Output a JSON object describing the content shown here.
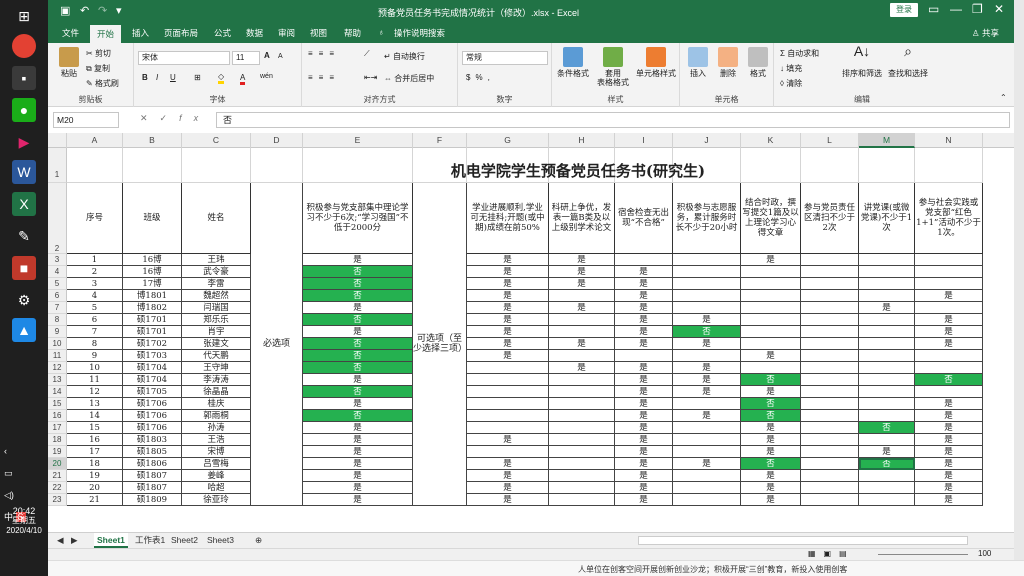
{
  "window": {
    "title": "预备党员任务书完成情况统计（修改）.xlsx  -  Excel",
    "login": "登录"
  },
  "menu": {
    "items": [
      "文件",
      "开始",
      "插入",
      "页面布局",
      "公式",
      "数据",
      "审阅",
      "视图",
      "帮助"
    ],
    "active": "开始",
    "tell_me": "操作说明搜索",
    "share": "共享"
  },
  "ribbon": {
    "clipboard": {
      "paste": "粘贴",
      "cut": "剪切",
      "copy": "复制",
      "painter": "格式刷",
      "label": "剪贴板"
    },
    "font": {
      "name": "宋体",
      "size": "11",
      "bold": "B",
      "italic": "I",
      "underline": "U",
      "grow": "A",
      "shrink": "A",
      "wen": "wén",
      "label": "字体"
    },
    "align": {
      "wrap": "自动换行",
      "merge": "合并后居中",
      "label": "对齐方式"
    },
    "number": {
      "format": "常规",
      "label": "数字"
    },
    "styles": {
      "cond": "条件格式",
      "table": "套用\n表格格式",
      "cell": "单元格样式",
      "label": "样式"
    },
    "cells": {
      "insert": "插入",
      "delete": "删除",
      "format": "格式",
      "label": "单元格"
    },
    "edit": {
      "autosum": "自动求和",
      "fill": "填充",
      "clear": "清除",
      "sort": "排序和筛选",
      "find": "查找和选择",
      "label": "编辑"
    }
  },
  "formula": {
    "cell_ref": "M20",
    "value": "否"
  },
  "columns": [
    "A",
    "B",
    "C",
    "D",
    "E",
    "F",
    "G",
    "H",
    "I",
    "J",
    "K",
    "L",
    "M",
    "N"
  ],
  "selected_col": "M",
  "selected_row": "20",
  "sheet_title": "机电学院学生预备党员任务书(研究生)",
  "headers": {
    "A": "序号",
    "B": "班级",
    "C": "姓名",
    "E": "积极参与党支部集中理论学习不少于6次;“学习强国”不低于2000分",
    "G": "学业进展顺利,学业可无挂科;开题(或中期)成绩在前50%",
    "H": "科研上争优，发表一篇B类及以上级别学术论文",
    "I": "宿舍检查无出现“不合格”",
    "J": "积极参与志愿服务，累计服务时长不少于20小时",
    "K": "结合时政，撰写提交1篇及以上理论学习心得文章",
    "L": "参与党员责任区清扫不少于2次",
    "M": "讲党课(或微党课)不少于1次",
    "N": "参与社会实践或党支部“红色1+1”活动不少于1次。"
  },
  "merged": {
    "D": "必选项",
    "F": "可选项（至少选择三项）"
  },
  "yes": "是",
  "no": "否",
  "rows": [
    {
      "r": "3",
      "n": "1",
      "cls": "16博",
      "name": "王玮",
      "E": "是",
      "G": "是",
      "H": "是",
      "I": "",
      "J": "",
      "K": "是",
      "L": "",
      "M": "",
      "N": ""
    },
    {
      "r": "4",
      "n": "2",
      "cls": "16博",
      "name": "武令豪",
      "E": "否",
      "G": "是",
      "H": "是",
      "I": "是",
      "J": "",
      "K": "",
      "L": "",
      "M": "",
      "N": ""
    },
    {
      "r": "5",
      "n": "3",
      "cls": "17博",
      "name": "李雷",
      "E": "否",
      "G": "是",
      "H": "是",
      "I": "是",
      "J": "",
      "K": "",
      "L": "",
      "M": "",
      "N": ""
    },
    {
      "r": "6",
      "n": "4",
      "cls": "博1801",
      "name": "魏超然",
      "E": "否",
      "G": "是",
      "H": "",
      "I": "是",
      "J": "",
      "K": "",
      "L": "",
      "M": "",
      "N": "是"
    },
    {
      "r": "7",
      "n": "5",
      "cls": "博1802",
      "name": "闫瑞国",
      "E": "是",
      "G": "是",
      "H": "是",
      "I": "是",
      "J": "",
      "K": "",
      "L": "",
      "M": "是",
      "N": ""
    },
    {
      "r": "8",
      "n": "6",
      "cls": "硕1701",
      "name": "郑乐乐",
      "E": "否",
      "G": "是",
      "H": "",
      "I": "是",
      "J": "是",
      "K": "",
      "L": "",
      "M": "",
      "N": "是"
    },
    {
      "r": "9",
      "n": "7",
      "cls": "硕1701",
      "name": "肖宇",
      "E": "是",
      "G": "是",
      "H": "",
      "I": "是",
      "J": "否",
      "K": "",
      "L": "",
      "M": "",
      "N": "是"
    },
    {
      "r": "10",
      "n": "8",
      "cls": "硕1702",
      "name": "张建文",
      "E": "否",
      "G": "是",
      "H": "是",
      "I": "是",
      "J": "是",
      "K": "",
      "L": "",
      "M": "",
      "N": "是"
    },
    {
      "r": "11",
      "n": "9",
      "cls": "硕1703",
      "name": "代天鹏",
      "E": "否",
      "G": "是",
      "H": "",
      "I": "",
      "J": "",
      "K": "是",
      "L": "",
      "M": "",
      "N": ""
    },
    {
      "r": "12",
      "n": "10",
      "cls": "硕1704",
      "name": "王守坤",
      "E": "否",
      "G": "",
      "H": "是",
      "I": "是",
      "J": "是",
      "K": "",
      "L": "",
      "M": "",
      "N": ""
    },
    {
      "r": "13",
      "n": "11",
      "cls": "硕1704",
      "name": "李涛涛",
      "E": "是",
      "G": "",
      "H": "",
      "I": "是",
      "J": "是",
      "K": "否",
      "L": "",
      "M": "",
      "N": "否"
    },
    {
      "r": "14",
      "n": "12",
      "cls": "硕1705",
      "name": "徐晶晶",
      "E": "否",
      "G": "",
      "H": "",
      "I": "是",
      "J": "是",
      "K": "是",
      "L": "",
      "M": "",
      "N": ""
    },
    {
      "r": "15",
      "n": "13",
      "cls": "硕1706",
      "name": "桂庆",
      "E": "是",
      "G": "",
      "H": "",
      "I": "是",
      "J": "",
      "K": "否",
      "L": "",
      "M": "",
      "N": "是"
    },
    {
      "r": "16",
      "n": "14",
      "cls": "硕1706",
      "name": "郭雨桐",
      "E": "否",
      "G": "",
      "H": "",
      "I": "是",
      "J": "是",
      "K": "否",
      "L": "",
      "M": "",
      "N": "是"
    },
    {
      "r": "17",
      "n": "15",
      "cls": "硕1706",
      "name": "孙涛",
      "E": "是",
      "G": "",
      "H": "",
      "I": "是",
      "J": "",
      "K": "是",
      "L": "",
      "M": "否",
      "N": "是"
    },
    {
      "r": "18",
      "n": "16",
      "cls": "硕1803",
      "name": "王浩",
      "E": "是",
      "G": "是",
      "H": "",
      "I": "是",
      "J": "",
      "K": "是",
      "L": "",
      "M": "",
      "N": "是"
    },
    {
      "r": "19",
      "n": "17",
      "cls": "硕1805",
      "name": "宋博",
      "E": "是",
      "G": "",
      "H": "",
      "I": "是",
      "J": "",
      "K": "是",
      "L": "",
      "M": "是",
      "N": "是"
    },
    {
      "r": "20",
      "n": "18",
      "cls": "硕1806",
      "name": "吕雪梅",
      "E": "是",
      "G": "是",
      "H": "",
      "I": "是",
      "J": "是",
      "K": "否",
      "L": "",
      "M": "否",
      "N": "是"
    },
    {
      "r": "21",
      "n": "19",
      "cls": "硕1807",
      "name": "姜峰",
      "E": "是",
      "G": "是",
      "H": "",
      "I": "是",
      "J": "",
      "K": "是",
      "L": "",
      "M": "",
      "N": "是"
    },
    {
      "r": "22",
      "n": "20",
      "cls": "硕1807",
      "name": "哈超",
      "E": "是",
      "G": "是",
      "H": "",
      "I": "是",
      "J": "",
      "K": "是",
      "L": "",
      "M": "",
      "N": "是"
    },
    {
      "r": "23",
      "n": "21",
      "cls": "硕1809",
      "name": "徐亚玲",
      "E": "是",
      "G": "是",
      "H": "",
      "I": "是",
      "J": "",
      "K": "是",
      "L": "",
      "M": "",
      "N": "是"
    }
  ],
  "sheets": [
    "Sheet1",
    "工作表1",
    "Sheet2",
    "Sheet3"
  ],
  "active_sheet": "Sheet1",
  "zoom": "100",
  "taskbar": {
    "time": "20:42",
    "day": "星期五",
    "date": "2020/4/10",
    "ime": "中"
  },
  "bottom_text": "人单位在创客空间开展创新创业沙龙；积极开展“三创”教育，新投入使用创客",
  "colors": {
    "excel_green": "#217346",
    "cell_green": "#25b150"
  }
}
